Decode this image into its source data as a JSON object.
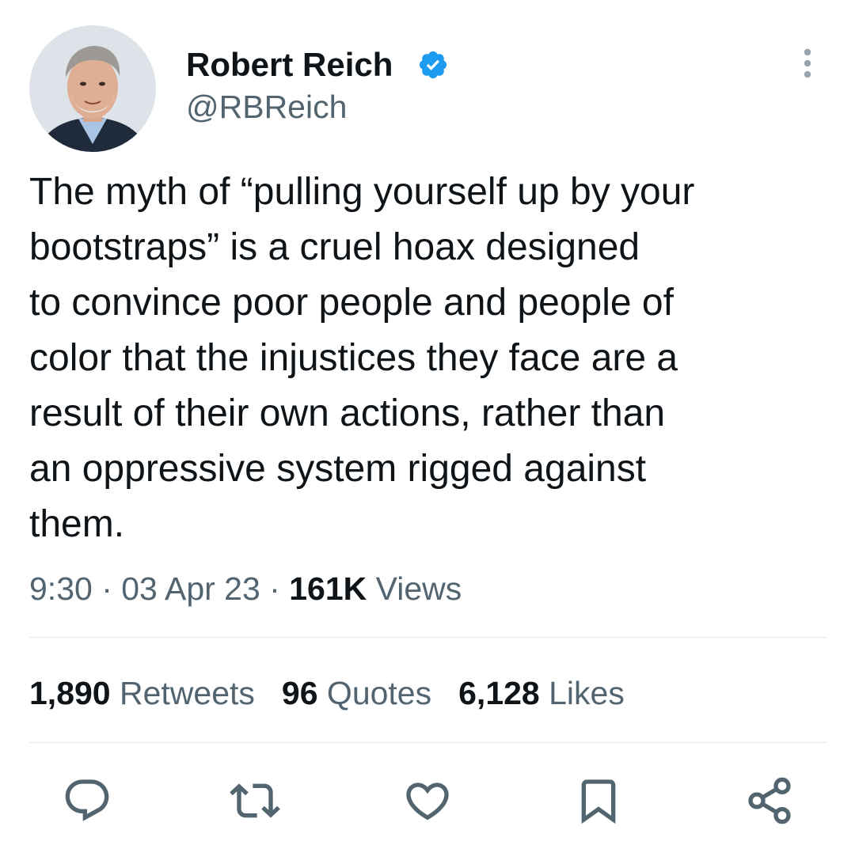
{
  "author": {
    "name": "Robert Reich",
    "handle": "@RBReich",
    "verified": true
  },
  "tweet": {
    "text": "The myth of “pulling yourself up by your\nbootstraps” is a cruel hoax designed\nto convince poor people and people of\ncolor that the injustices they face are a\nresult of their own actions, rather than\nan oppressive system rigged against\nthem."
  },
  "meta": {
    "time": "9:30",
    "separator": " · ",
    "date": "03 Apr 23",
    "views_count": "161K",
    "views_label": " Views"
  },
  "stats": {
    "retweets": {
      "count": "1,890",
      "label": " Retweets"
    },
    "quotes": {
      "count": "96",
      "label": " Quotes"
    },
    "likes": {
      "count": "6,128",
      "label": " Likes"
    }
  },
  "icons": {
    "verified": "verified-badge-icon",
    "more": "more-options-icon",
    "reply": "reply-icon",
    "retweet": "retweet-icon",
    "like": "heart-icon",
    "bookmark": "bookmark-icon",
    "share": "share-icon"
  },
  "colors": {
    "text_primary": "#0f1419",
    "text_secondary": "#536471",
    "verified_blue": "#1d9bf0",
    "divider": "#e6e9ec"
  }
}
